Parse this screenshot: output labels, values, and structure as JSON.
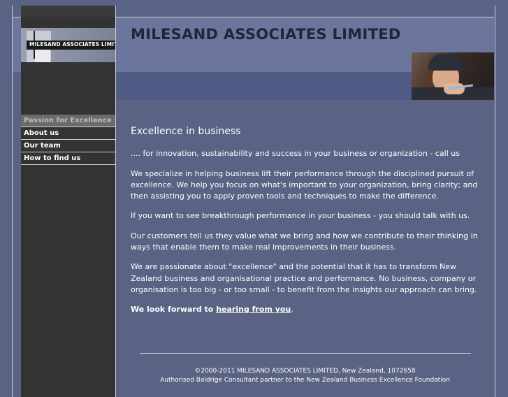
{
  "header": {
    "logo_text": "MILESAND ASSOCIATES LIMITED",
    "site_title": "MILESAND  ASSOCIATES  LIMITED"
  },
  "nav": {
    "items": [
      {
        "label": "Passion for Excellence",
        "active": true
      },
      {
        "label": "About us",
        "active": false
      },
      {
        "label": "Our team",
        "active": false
      },
      {
        "label": "How to find us",
        "active": false
      }
    ]
  },
  "main": {
    "heading": "Excellence in business",
    "paragraphs": [
      ".... for innovation, sustainability and success in your business or organization - call us",
      "We specialize in helping business lift their performance through the disciplined pursuit of excellence.  We help you focus on what's important to your organization, bring clarity; and then assisting you to apply proven tools and techniques to make the difference.",
      "If you want to see breakthrough performance in your business - you should talk with us.",
      "Our customers tell us they value what we bring and how we contribute to their thinking in ways that enable them to make real improvements in their business.",
      "We are passionate about \"excellence\" and the potential that it has to transform New Zealand business and organisational practice and performance.  No business, company or organisation is too big - or too small - to benefit from the insights our approach can bring."
    ],
    "closing_text": "We look forward to",
    "closing_link": "hearing from you",
    "closing_end": "."
  },
  "footer": {
    "line1": "©2000-2011 MILESAND ASSOCIATES LIMITED, New Zealand, 1072658",
    "line2": "Authorised Baldrige Consultant partner to the New Zealand Business Excellence Foundation"
  },
  "colors": {
    "background": "#5a6384",
    "header_band": "#6c759b",
    "sidebar": "#333333"
  }
}
